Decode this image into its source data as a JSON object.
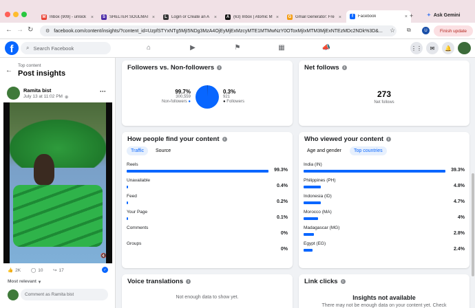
{
  "browser": {
    "tabs": [
      {
        "title": "Inbox (909) - unlock",
        "icon": "gmail-icon",
        "color": "#ea4335",
        "glyph": "M"
      },
      {
        "title": "SHELTER SOULMATE",
        "icon": "shelter-icon",
        "color": "#4b2aa8",
        "glyph": "S"
      },
      {
        "title": "Login or Create an A",
        "icon": "login-icon",
        "color": "#333333",
        "glyph": "L"
      },
      {
        "title": "(63) Inbox | Atomic M",
        "icon": "atomic-mail-icon",
        "color": "#111111",
        "glyph": "A"
      },
      {
        "title": "Gmail Generator: Fre",
        "icon": "generator-icon",
        "color": "#f39c12",
        "glyph": "G"
      },
      {
        "title": "Facebook",
        "icon": "facebook-icon",
        "color": "#0866ff",
        "glyph": "f"
      }
    ],
    "ask_label": "Ask Gemini",
    "url": "facebook.com/content/insights/?content_id=UzpfSTYxNTg5MjI5NDg3MzA4OjEyMjExMzcyMTE1MTMwNzY0OToxMjIxMTM3MjExNTEzMDc2NDk%3D&...",
    "finish_update_label": "Finish update",
    "profile_initial": "U"
  },
  "facebook": {
    "search_placeholder": "Search Facebook"
  },
  "left": {
    "breadcrumb": "Top content",
    "page_title": "Post insights",
    "author": "Ramita bist",
    "post_meta": "July 13 at 11:02 PM",
    "reactions_count": "2K",
    "comments_count": "10",
    "shares_count": "17",
    "sort_label": "Most relevant",
    "comment_placeholder": "Comment as Ramita bist"
  },
  "followers": {
    "title": "Followers vs. Non-followers",
    "non_followers_pct": "99.7%",
    "non_followers_count": "300,559",
    "non_followers_label": "Non-followers",
    "followers_pct": "0.3%",
    "followers_count": "921",
    "followers_label": "Followers",
    "followers_share": 0.003,
    "accent": "#0866ff"
  },
  "net_follows": {
    "title": "Net follows",
    "value": "273",
    "label": "Net follows"
  },
  "find_content": {
    "title": "How people find your content",
    "tabs": [
      "Traffic",
      "Source"
    ],
    "rows": [
      {
        "label": "Reels",
        "pct": "99.3%",
        "value": 99.3
      },
      {
        "label": "Unavailable",
        "pct": "0.4%",
        "value": 0.4
      },
      {
        "label": "Feed",
        "pct": "0.2%",
        "value": 0.2
      },
      {
        "label": "Your Page",
        "pct": "0.1%",
        "value": 0.1
      },
      {
        "label": "Comments",
        "pct": "0%",
        "value": 0
      },
      {
        "label": "Groups",
        "pct": "0%",
        "value": 0
      }
    ]
  },
  "viewers": {
    "title": "Who viewed your content",
    "tabs": [
      "Age and gender",
      "Top countries"
    ],
    "rows": [
      {
        "label": "India (IN)",
        "pct": "39.3%",
        "value": 39.3
      },
      {
        "label": "Philippines (PH)",
        "pct": "4.8%",
        "value": 4.8
      },
      {
        "label": "Indonesia (ID)",
        "pct": "4.7%",
        "value": 4.7
      },
      {
        "label": "Morocco (MA)",
        "pct": "4%",
        "value": 4
      },
      {
        "label": "Madagascar (MG)",
        "pct": "2.8%",
        "value": 2.8
      },
      {
        "label": "Egypt (EG)",
        "pct": "2.4%",
        "value": 2.4
      }
    ]
  },
  "voice": {
    "title": "Voice translations",
    "message": "Not enough data to show yet."
  },
  "link_clicks": {
    "title": "Link clicks",
    "heading": "Insights not available",
    "message": "There may not be enough data on your content yet. Check"
  }
}
